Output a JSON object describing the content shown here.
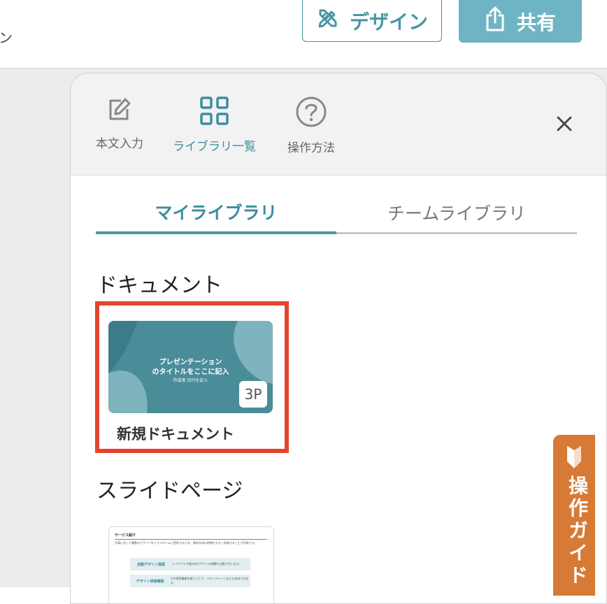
{
  "topbar": {
    "left_text": "ン",
    "design_label": "デザイン",
    "share_label": "共有"
  },
  "panel": {
    "tools": [
      {
        "label": "本文入力",
        "icon": "edit-icon"
      },
      {
        "label": "ライブラリ一覧",
        "icon": "grid-icon"
      },
      {
        "label": "操作方法",
        "icon": "help-icon"
      }
    ],
    "tabs": {
      "my_library": "マイライブラリ",
      "team_library": "チームライブラリ"
    },
    "documents": {
      "section_title": "ドキュメント",
      "card": {
        "title_line1": "プレゼンテーション",
        "title_line2": "のタイトルをここに記入",
        "subtitle": "作成者 日付を記入",
        "page_badge": "3P",
        "name": "新規ドキュメント"
      }
    },
    "slides": {
      "section_title": "スライドページ",
      "card": {
        "heading": "サービス紹介",
        "line": "文章に対して複数のデザインをリアルタイムに提案するため、資料作成の時間を大きく短縮することが可能です。",
        "rows": [
          {
            "key": "自動デザイン提案",
            "value": "レイアウトや組み合デザインの調整も自動で行います。"
          },
          {
            "key": "デザイン検索機能",
            "value": "ネタ探索機能を使うことで、フローチャートなども作成できます。"
          }
        ]
      }
    }
  },
  "guide": {
    "label": "操作ガイド"
  },
  "colors": {
    "accent": "#4a97a4",
    "share_bg": "#6fb4c4",
    "highlight": "#e5432d",
    "guide_bg": "#d77a36"
  }
}
